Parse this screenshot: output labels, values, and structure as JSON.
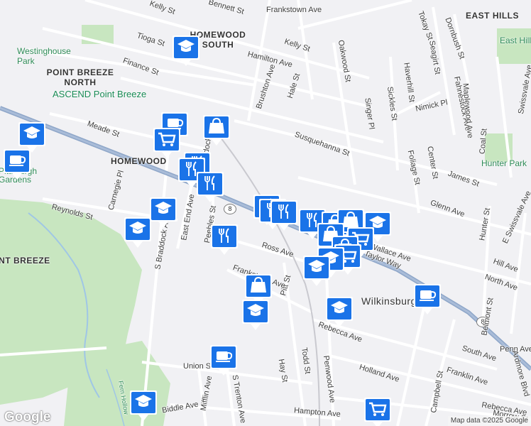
{
  "neighborhoods": [
    "EAST HILLS",
    "HOMEWOOD SOUTH",
    "POINT BREEZE NORTH",
    "HOMEWOOD",
    "POINT BREEZE",
    "Wilkinsburg"
  ],
  "parks": [
    "Westinghouse Park",
    "Hunter Park",
    "East Hills",
    "Pittsburgh Gardens"
  ],
  "poi": [
    "ASCEND Point Breeze"
  ],
  "streets": [
    "Kelly St",
    "Bennett St",
    "Frankstown Ave",
    "Tioga St",
    "Hamilton Ave",
    "Finance St",
    "Brushton Ave",
    "Hale St",
    "Oakwood St",
    "Meade St",
    "Susquehanna St",
    "Tokay St",
    "Dornbush St",
    "Seagirt St",
    "Fahnestock Ave",
    "Haverhill St",
    "Nimick Pl",
    "Sickles St",
    "Singer Pl",
    "Maplewood Ave",
    "Swissvale Ave",
    "Coal St",
    "Center St",
    "Foliage St",
    "James St",
    "Carnegie Pl",
    "Reynolds St",
    "S Braddock Ave",
    "East End Ave",
    "Peebles St",
    "N Braddock Ave",
    "Ross Ave",
    "Glenn Ave",
    "Wallace Ave",
    "Taylor Way",
    "Hunter St",
    "E Swissvale Ave",
    "Hill Ave",
    "North Ave",
    "Penn Ave",
    "Pitt St",
    "Rebecca Ave",
    "Frankstown Ave",
    "Todd St",
    "Penwood Ave",
    "Hay St",
    "Holland Ave",
    "South Ave",
    "Franklin Ave",
    "Union St",
    "Biddle Ave",
    "Mifflin Ave",
    "S Trenton Ave",
    "Hampton Ave",
    "Belmont St",
    "Ardmore Blvd",
    "Campbell St",
    "Fern Hollow",
    "Rebecca Ave",
    "Morrow St",
    "Kelly St"
  ],
  "route": "8",
  "branding": {
    "logo": "Google",
    "attribution": "Map data ©2025 Google"
  },
  "colors": {
    "marker": "#1a73e8",
    "park": "#c8e6c0",
    "highway": "#8ea6c8",
    "road": "#ffffff",
    "background": "#f1f1f4"
  },
  "markers": [
    {
      "icon": "school-icon",
      "name": "school"
    },
    {
      "icon": "cafe-icon",
      "name": "cafe"
    },
    {
      "icon": "school-icon",
      "name": "school"
    },
    {
      "icon": "cafe-icon",
      "name": "cafe"
    },
    {
      "icon": "shopping-cart-icon",
      "name": "grocery"
    },
    {
      "icon": "shopping-bag-icon",
      "name": "store"
    },
    {
      "icon": "restaurant-icon",
      "name": "restaurant"
    },
    {
      "icon": "restaurant-icon",
      "name": "restaurant"
    },
    {
      "icon": "restaurant-icon",
      "name": "restaurant"
    },
    {
      "icon": "school-icon",
      "name": "school"
    },
    {
      "icon": "school-icon",
      "name": "school"
    },
    {
      "icon": "restaurant-icon",
      "name": "restaurant"
    },
    {
      "icon": "restaurant-icon",
      "name": "restaurant"
    },
    {
      "icon": "restaurant-icon",
      "name": "restaurant"
    },
    {
      "icon": "restaurant-icon",
      "name": "restaurant"
    },
    {
      "icon": "restaurant-icon",
      "name": "restaurant"
    },
    {
      "icon": "shopping-bag-icon",
      "name": "store"
    },
    {
      "icon": "shopping-bag-icon",
      "name": "store"
    },
    {
      "icon": "school-icon",
      "name": "school"
    },
    {
      "icon": "shopping-cart-icon",
      "name": "grocery"
    },
    {
      "icon": "shopping-bag-icon",
      "name": "store"
    },
    {
      "icon": "shopping-bag-icon",
      "name": "store"
    },
    {
      "icon": "shopping-cart-icon",
      "name": "grocery"
    },
    {
      "icon": "school-icon",
      "name": "school"
    },
    {
      "icon": "school-icon",
      "name": "school"
    },
    {
      "icon": "cafe-icon",
      "name": "cafe"
    },
    {
      "icon": "shopping-bag-icon",
      "name": "store"
    },
    {
      "icon": "school-icon",
      "name": "school"
    },
    {
      "icon": "school-icon",
      "name": "school"
    },
    {
      "icon": "cafe-icon",
      "name": "cafe"
    },
    {
      "icon": "school-icon",
      "name": "school"
    },
    {
      "icon": "shopping-cart-icon",
      "name": "grocery"
    }
  ]
}
